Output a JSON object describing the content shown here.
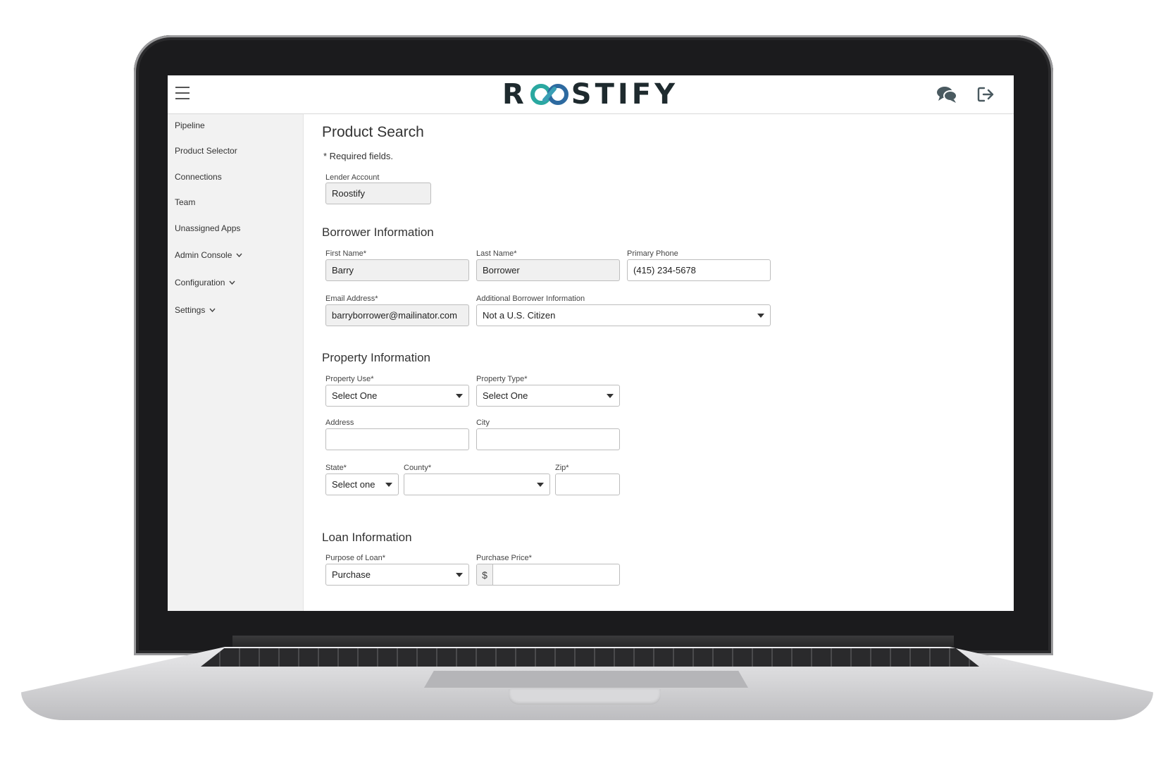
{
  "app": {
    "logo_prefix": "R",
    "logo_suffix": "STIFY"
  },
  "sidebar": {
    "items": [
      {
        "label": "Pipeline"
      },
      {
        "label": "Product Selector"
      },
      {
        "label": "Connections"
      },
      {
        "label": "Team"
      },
      {
        "label": "Unassigned Apps"
      },
      {
        "label": "Admin Console"
      },
      {
        "label": "Configuration"
      },
      {
        "label": "Settings"
      }
    ]
  },
  "page": {
    "title": "Product Search",
    "required_note": "* Required fields."
  },
  "lender": {
    "label": "Lender Account",
    "value": "Roostify"
  },
  "borrower": {
    "heading": "Borrower Information",
    "first_name_label": "First Name*",
    "first_name_value": "Barry",
    "last_name_label": "Last Name*",
    "last_name_value": "Borrower",
    "phone_label": "Primary Phone",
    "phone_value": "(415) 234-5678",
    "email_label": "Email Address*",
    "email_value": "barryborrower@mailinator.com",
    "additional_label": "Additional Borrower Information",
    "additional_value": "Not a U.S. Citizen"
  },
  "property": {
    "heading": "Property Information",
    "use_label": "Property Use*",
    "use_value": "Select One",
    "type_label": "Property Type*",
    "type_value": "Select One",
    "address_label": "Address",
    "address_value": "",
    "city_label": "City",
    "city_value": "",
    "state_label": "State*",
    "state_value": "Select one",
    "county_label": "County*",
    "county_value": "",
    "zip_label": "Zip*",
    "zip_value": ""
  },
  "loan": {
    "heading": "Loan Information",
    "purpose_label": "Purpose of Loan*",
    "purpose_value": "Purchase",
    "price_label": "Purchase Price*",
    "currency_symbol": "$",
    "price_value": ""
  },
  "colors": {
    "logo_dark": "#1e2a2e",
    "logo_teal": "#2aa8a0",
    "logo_blue": "#2d6aa0",
    "sidebar_bg": "#f2f2f2",
    "field_filled_bg": "#f0f0f0"
  },
  "icons": {
    "menu": "hamburger-icon",
    "logo_loop": "infinity-loop-icon",
    "chat": "chat-bubbles-icon",
    "logout": "logout-icon",
    "chevron": "chevron-down-icon",
    "dropdown": "caret-down-icon"
  }
}
